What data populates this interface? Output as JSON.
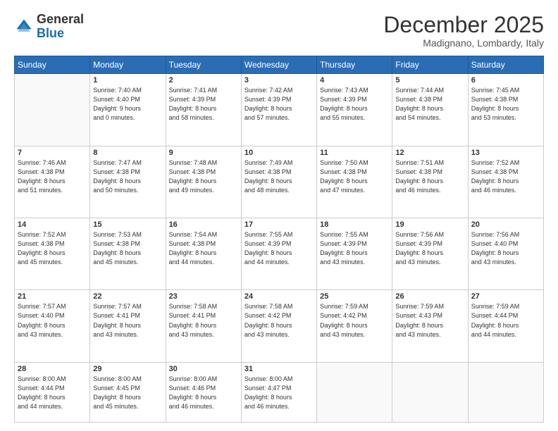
{
  "logo": {
    "general": "General",
    "blue": "Blue"
  },
  "header": {
    "month": "December 2025",
    "location": "Madignano, Lombardy, Italy"
  },
  "weekdays": [
    "Sunday",
    "Monday",
    "Tuesday",
    "Wednesday",
    "Thursday",
    "Friday",
    "Saturday"
  ],
  "weeks": [
    [
      {
        "day": "",
        "info": ""
      },
      {
        "day": "1",
        "info": "Sunrise: 7:40 AM\nSunset: 4:40 PM\nDaylight: 9 hours\nand 0 minutes."
      },
      {
        "day": "2",
        "info": "Sunrise: 7:41 AM\nSunset: 4:39 PM\nDaylight: 8 hours\nand 58 minutes."
      },
      {
        "day": "3",
        "info": "Sunrise: 7:42 AM\nSunset: 4:39 PM\nDaylight: 8 hours\nand 57 minutes."
      },
      {
        "day": "4",
        "info": "Sunrise: 7:43 AM\nSunset: 4:39 PM\nDaylight: 8 hours\nand 55 minutes."
      },
      {
        "day": "5",
        "info": "Sunrise: 7:44 AM\nSunset: 4:38 PM\nDaylight: 8 hours\nand 54 minutes."
      },
      {
        "day": "6",
        "info": "Sunrise: 7:45 AM\nSunset: 4:38 PM\nDaylight: 8 hours\nand 53 minutes."
      }
    ],
    [
      {
        "day": "7",
        "info": "Sunrise: 7:46 AM\nSunset: 4:38 PM\nDaylight: 8 hours\nand 51 minutes."
      },
      {
        "day": "8",
        "info": "Sunrise: 7:47 AM\nSunset: 4:38 PM\nDaylight: 8 hours\nand 50 minutes."
      },
      {
        "day": "9",
        "info": "Sunrise: 7:48 AM\nSunset: 4:38 PM\nDaylight: 8 hours\nand 49 minutes."
      },
      {
        "day": "10",
        "info": "Sunrise: 7:49 AM\nSunset: 4:38 PM\nDaylight: 8 hours\nand 48 minutes."
      },
      {
        "day": "11",
        "info": "Sunrise: 7:50 AM\nSunset: 4:38 PM\nDaylight: 8 hours\nand 47 minutes."
      },
      {
        "day": "12",
        "info": "Sunrise: 7:51 AM\nSunset: 4:38 PM\nDaylight: 8 hours\nand 46 minutes."
      },
      {
        "day": "13",
        "info": "Sunrise: 7:52 AM\nSunset: 4:38 PM\nDaylight: 8 hours\nand 46 minutes."
      }
    ],
    [
      {
        "day": "14",
        "info": "Sunrise: 7:52 AM\nSunset: 4:38 PM\nDaylight: 8 hours\nand 45 minutes."
      },
      {
        "day": "15",
        "info": "Sunrise: 7:53 AM\nSunset: 4:38 PM\nDaylight: 8 hours\nand 45 minutes."
      },
      {
        "day": "16",
        "info": "Sunrise: 7:54 AM\nSunset: 4:38 PM\nDaylight: 8 hours\nand 44 minutes."
      },
      {
        "day": "17",
        "info": "Sunrise: 7:55 AM\nSunset: 4:39 PM\nDaylight: 8 hours\nand 44 minutes."
      },
      {
        "day": "18",
        "info": "Sunrise: 7:55 AM\nSunset: 4:39 PM\nDaylight: 8 hours\nand 43 minutes."
      },
      {
        "day": "19",
        "info": "Sunrise: 7:56 AM\nSunset: 4:39 PM\nDaylight: 8 hours\nand 43 minutes."
      },
      {
        "day": "20",
        "info": "Sunrise: 7:56 AM\nSunset: 4:40 PM\nDaylight: 8 hours\nand 43 minutes."
      }
    ],
    [
      {
        "day": "21",
        "info": "Sunrise: 7:57 AM\nSunset: 4:40 PM\nDaylight: 8 hours\nand 43 minutes."
      },
      {
        "day": "22",
        "info": "Sunrise: 7:57 AM\nSunset: 4:41 PM\nDaylight: 8 hours\nand 43 minutes."
      },
      {
        "day": "23",
        "info": "Sunrise: 7:58 AM\nSunset: 4:41 PM\nDaylight: 8 hours\nand 43 minutes."
      },
      {
        "day": "24",
        "info": "Sunrise: 7:58 AM\nSunset: 4:42 PM\nDaylight: 8 hours\nand 43 minutes."
      },
      {
        "day": "25",
        "info": "Sunrise: 7:59 AM\nSunset: 4:42 PM\nDaylight: 8 hours\nand 43 minutes."
      },
      {
        "day": "26",
        "info": "Sunrise: 7:59 AM\nSunset: 4:43 PM\nDaylight: 8 hours\nand 43 minutes."
      },
      {
        "day": "27",
        "info": "Sunrise: 7:59 AM\nSunset: 4:44 PM\nDaylight: 8 hours\nand 44 minutes."
      }
    ],
    [
      {
        "day": "28",
        "info": "Sunrise: 8:00 AM\nSunset: 4:44 PM\nDaylight: 8 hours\nand 44 minutes."
      },
      {
        "day": "29",
        "info": "Sunrise: 8:00 AM\nSunset: 4:45 PM\nDaylight: 8 hours\nand 45 minutes."
      },
      {
        "day": "30",
        "info": "Sunrise: 8:00 AM\nSunset: 4:46 PM\nDaylight: 8 hours\nand 46 minutes."
      },
      {
        "day": "31",
        "info": "Sunrise: 8:00 AM\nSunset: 4:47 PM\nDaylight: 8 hours\nand 46 minutes."
      },
      {
        "day": "",
        "info": ""
      },
      {
        "day": "",
        "info": ""
      },
      {
        "day": "",
        "info": ""
      }
    ]
  ]
}
